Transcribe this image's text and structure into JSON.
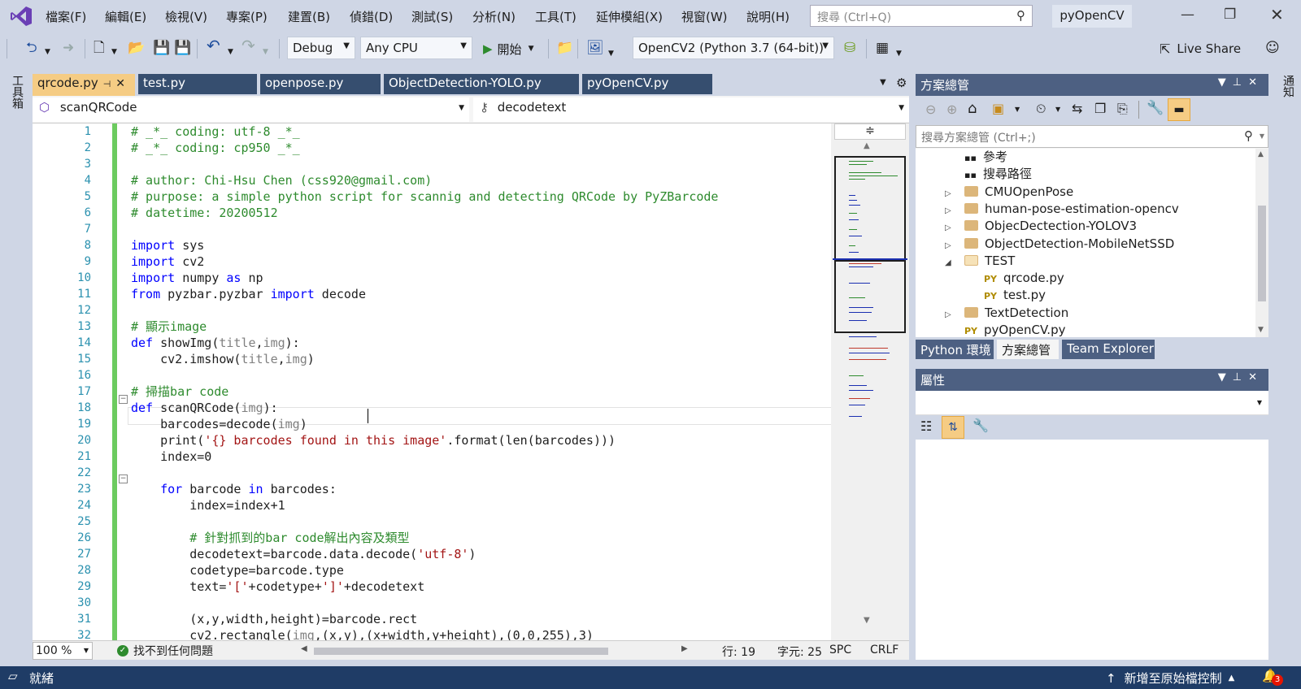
{
  "menu": {
    "items": [
      "檔案(F)",
      "編輯(E)",
      "檢視(V)",
      "專案(P)",
      "建置(B)",
      "偵錯(D)",
      "測試(S)",
      "分析(N)",
      "工具(T)",
      "延伸模組(X)",
      "視窗(W)",
      "說明(H)"
    ],
    "search_placeholder": "搜尋 (Ctrl+Q)",
    "project_name": "pyOpenCV"
  },
  "toolbar": {
    "config": "Debug",
    "platform": "Any CPU",
    "start_label": "開始",
    "environment": "OpenCV2 (Python 3.7 (64-bit))",
    "live_share": "Live Share"
  },
  "left_strip": {
    "label": "工具箱"
  },
  "right_strip": {
    "label": "通知"
  },
  "doc_tabs": [
    "qrcode.py",
    "test.py",
    "openpose.py",
    "ObjectDetection-YOLO.py",
    "pyOpenCV.py"
  ],
  "nav": {
    "scope": "scanQRCode",
    "member": "decodetext"
  },
  "editor": {
    "line_numbers": [
      "1",
      "2",
      "3",
      "4",
      "5",
      "6",
      "7",
      "8",
      "9",
      "10",
      "11",
      "12",
      "13",
      "14",
      "15",
      "16",
      "17",
      "18",
      "19",
      "20",
      "21",
      "22",
      "23",
      "24",
      "25",
      "26",
      "27",
      "28",
      "29",
      "30",
      "31",
      "32"
    ],
    "lines": [
      [
        {
          "t": "c",
          "v": "# _*_ coding: utf-8 _*_"
        }
      ],
      [
        {
          "t": "c",
          "v": "# _*_ coding: cp950 _*_"
        }
      ],
      [],
      [
        {
          "t": "c",
          "v": "# author: Chi-Hsu Chen (css920@gmail.com)"
        }
      ],
      [
        {
          "t": "c",
          "v": "# purpose: a simple python script for scannig and detecting QRCode by PyZBarcode"
        }
      ],
      [
        {
          "t": "c",
          "v": "# datetime: 20200512"
        }
      ],
      [],
      [
        {
          "t": "k",
          "v": "import"
        },
        {
          "t": "n",
          "v": " sys"
        }
      ],
      [
        {
          "t": "k",
          "v": "import"
        },
        {
          "t": "n",
          "v": " cv2"
        }
      ],
      [
        {
          "t": "k",
          "v": "import"
        },
        {
          "t": "n",
          "v": " numpy "
        },
        {
          "t": "k",
          "v": "as"
        },
        {
          "t": "n",
          "v": " np"
        }
      ],
      [
        {
          "t": "k",
          "v": "from"
        },
        {
          "t": "n",
          "v": " pyzbar.pyzbar "
        },
        {
          "t": "k",
          "v": "import"
        },
        {
          "t": "n",
          "v": " decode"
        }
      ],
      [],
      [
        {
          "t": "c",
          "v": "# 顯示image"
        }
      ],
      [
        {
          "t": "k",
          "v": "def"
        },
        {
          "t": "n",
          "v": " showImg("
        },
        {
          "t": "p",
          "v": "title"
        },
        {
          "t": "n",
          "v": ","
        },
        {
          "t": "p",
          "v": "img"
        },
        {
          "t": "n",
          "v": "):"
        }
      ],
      [
        {
          "t": "n",
          "v": "    cv2.imshow("
        },
        {
          "t": "p",
          "v": "title"
        },
        {
          "t": "n",
          "v": ","
        },
        {
          "t": "p",
          "v": "img"
        },
        {
          "t": "n",
          "v": ")"
        }
      ],
      [],
      [
        {
          "t": "c",
          "v": "# 掃描bar code"
        }
      ],
      [
        {
          "t": "k",
          "v": "def"
        },
        {
          "t": "n",
          "v": " scanQRCode("
        },
        {
          "t": "p",
          "v": "img"
        },
        {
          "t": "n",
          "v": "):"
        }
      ],
      [
        {
          "t": "n",
          "v": "    barcodes=decode("
        },
        {
          "t": "p",
          "v": "img"
        },
        {
          "t": "n",
          "v": ")"
        }
      ],
      [
        {
          "t": "n",
          "v": "    print("
        },
        {
          "t": "s",
          "v": "'{} barcodes found in this image'"
        },
        {
          "t": "n",
          "v": ".format(len(barcodes)))"
        }
      ],
      [
        {
          "t": "n",
          "v": "    index=0"
        }
      ],
      [],
      [
        {
          "t": "n",
          "v": "    "
        },
        {
          "t": "k",
          "v": "for"
        },
        {
          "t": "n",
          "v": " barcode "
        },
        {
          "t": "k",
          "v": "in"
        },
        {
          "t": "n",
          "v": " barcodes:"
        }
      ],
      [
        {
          "t": "n",
          "v": "        index=index+1"
        }
      ],
      [],
      [
        {
          "t": "c",
          "v": "        # 針對抓到的bar code解出內容及類型"
        }
      ],
      [
        {
          "t": "n",
          "v": "        decodetext=barcode.data.decode("
        },
        {
          "t": "s",
          "v": "'utf-8'"
        },
        {
          "t": "n",
          "v": ")"
        }
      ],
      [
        {
          "t": "n",
          "v": "        codetype=barcode.type"
        }
      ],
      [
        {
          "t": "n",
          "v": "        text="
        },
        {
          "t": "s",
          "v": "'['"
        },
        {
          "t": "n",
          "v": "+codetype+"
        },
        {
          "t": "s",
          "v": "']'"
        },
        {
          "t": "n",
          "v": "+decodetext"
        }
      ],
      [],
      [
        {
          "t": "n",
          "v": "        (x,y,width,height)=barcode.rect"
        }
      ],
      [
        {
          "t": "n",
          "v": "        cv2.rectangle("
        },
        {
          "t": "p",
          "v": "img"
        },
        {
          "t": "n",
          "v": ",(x,y),(x+width,y+height),(0,0,255),3)"
        }
      ]
    ]
  },
  "editor_status": {
    "zoom": "100 %",
    "issues": "找不到任何問題",
    "line": "行: 19",
    "col": "字元: 25",
    "whitespace": "SPC",
    "eol": "CRLF"
  },
  "solution_explorer": {
    "title": "方案總管",
    "search_placeholder": "搜尋方案總管 (Ctrl+;)",
    "items": [
      {
        "label": "參考",
        "kind": "ref",
        "expander": ""
      },
      {
        "label": "搜尋路徑",
        "kind": "ref",
        "expander": ""
      },
      {
        "label": "CMUOpenPose",
        "kind": "folder",
        "expander": "▷"
      },
      {
        "label": "human-pose-estimation-opencv",
        "kind": "folder",
        "expander": "▷"
      },
      {
        "label": "ObjecDectection-YOLOV3",
        "kind": "folder",
        "expander": "▷"
      },
      {
        "label": "ObjectDetection-MobileNetSSD",
        "kind": "folder",
        "expander": "▷"
      },
      {
        "label": "TEST",
        "kind": "folder-open",
        "expander": "◢"
      },
      {
        "label": "qrcode.py",
        "kind": "py",
        "expander": ""
      },
      {
        "label": "test.py",
        "kind": "py",
        "expander": ""
      },
      {
        "label": "TextDetection",
        "kind": "folder",
        "expander": "▷"
      },
      {
        "label": "pyOpenCV.py",
        "kind": "py",
        "expander": ""
      }
    ],
    "bottom_tabs": [
      "Python 環境",
      "方案總管",
      "Team Explorer"
    ]
  },
  "properties": {
    "title": "屬性"
  },
  "statusbar": {
    "ready": "就緒",
    "source_control": "新增至原始檔控制",
    "notification_count": "3"
  }
}
